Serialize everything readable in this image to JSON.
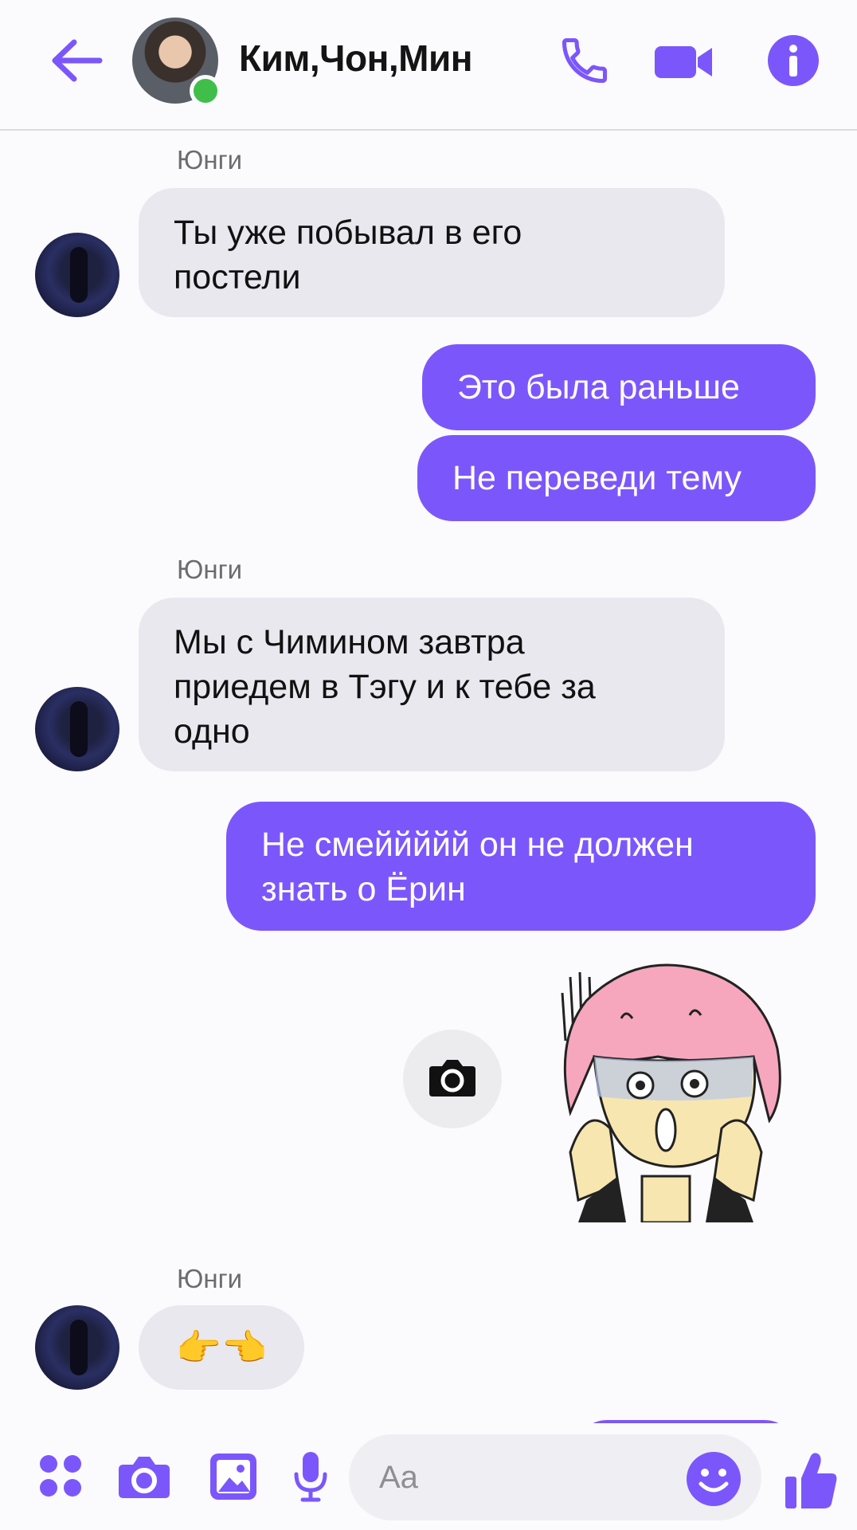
{
  "header": {
    "title": "Ким,Чон,Мин",
    "back_icon": "arrow-left-icon",
    "call_icon": "phone-icon",
    "video_icon": "video-camera-icon",
    "info_icon": "info-icon"
  },
  "messages": [
    {
      "type": "in",
      "sender": "Юнги",
      "text_lines": [
        "Ты уже побывал в его",
        "постели"
      ]
    },
    {
      "type": "out",
      "text": "Это была раньше"
    },
    {
      "type": "out",
      "text": "Не переведи тему"
    },
    {
      "type": "in",
      "sender": "Юнги",
      "text_lines": [
        "Мы с Чимином завтра",
        "приедем в Тэгу и к тебе за",
        "одно"
      ]
    },
    {
      "type": "out",
      "text_lines": [
        "Не смеййййй он не должен",
        "знать о Ёрин"
      ]
    },
    {
      "type": "sticker",
      "camera_icon": "camera-icon"
    },
    {
      "type": "in",
      "sender": "Юнги",
      "emoji": "👉👈"
    }
  ],
  "composer": {
    "placeholder": "Aa",
    "icons": [
      "apps-icon",
      "camera-icon",
      "gallery-icon",
      "microphone-icon",
      "emoji-icon",
      "thumbs-up-icon"
    ]
  },
  "colors": {
    "accent": "#7b57fb",
    "incoming_bubble": "#e9e8ee",
    "online": "#3fbf4a"
  }
}
